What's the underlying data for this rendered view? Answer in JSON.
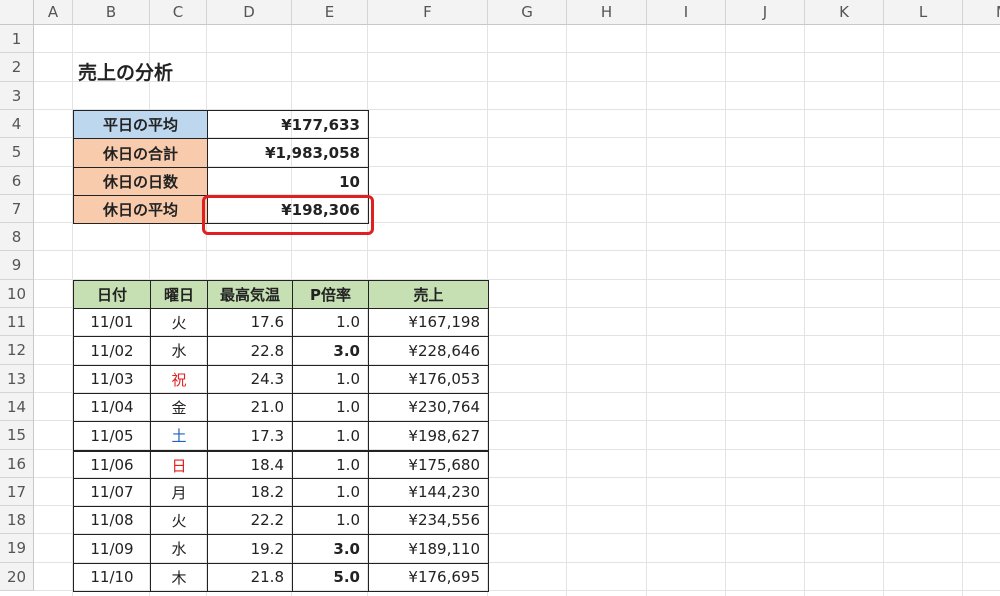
{
  "columns": [
    "A",
    "B",
    "C",
    "D",
    "E",
    "F",
    "G",
    "H",
    "I",
    "J",
    "K",
    "L",
    "M"
  ],
  "rows": [
    "1",
    "2",
    "3",
    "4",
    "5",
    "6",
    "7",
    "8",
    "9",
    "10",
    "11",
    "12",
    "13",
    "14",
    "15",
    "16",
    "17",
    "18",
    "19",
    "20"
  ],
  "title": "売上の分析",
  "summary": [
    {
      "label": "平日の平均",
      "value": "¥177,633"
    },
    {
      "label": "休日の合計",
      "value": "¥1,983,058"
    },
    {
      "label": "休日の日数",
      "value": "10"
    },
    {
      "label": "休日の平均",
      "value": "¥198,306"
    }
  ],
  "table": {
    "headers": [
      "日付",
      "曜日",
      "最高気温",
      "P倍率",
      "売上"
    ],
    "rows": [
      {
        "date": "11/01",
        "day": "火",
        "temp": "17.6",
        "rate": "1.0",
        "sales": "¥167,198"
      },
      {
        "date": "11/02",
        "day": "水",
        "temp": "22.8",
        "rate": "3.0",
        "sales": "¥228,646"
      },
      {
        "date": "11/03",
        "day": "祝",
        "temp": "24.3",
        "rate": "1.0",
        "sales": "¥176,053"
      },
      {
        "date": "11/04",
        "day": "金",
        "temp": "21.0",
        "rate": "1.0",
        "sales": "¥230,764"
      },
      {
        "date": "11/05",
        "day": "土",
        "temp": "17.3",
        "rate": "1.0",
        "sales": "¥198,627"
      },
      {
        "date": "11/06",
        "day": "日",
        "temp": "18.4",
        "rate": "1.0",
        "sales": "¥175,680"
      },
      {
        "date": "11/07",
        "day": "月",
        "temp": "18.2",
        "rate": "1.0",
        "sales": "¥144,230"
      },
      {
        "date": "11/08",
        "day": "火",
        "temp": "22.2",
        "rate": "1.0",
        "sales": "¥234,556"
      },
      {
        "date": "11/09",
        "day": "水",
        "temp": "19.2",
        "rate": "3.0",
        "sales": "¥189,110"
      },
      {
        "date": "11/10",
        "day": "木",
        "temp": "21.8",
        "rate": "5.0",
        "sales": "¥176,695"
      }
    ]
  },
  "colors": {
    "weekday_label_bg": "#bdd7ee",
    "holiday_label_bg": "#f8cbad",
    "table_header_bg": "#c6e0b4",
    "holiday_text": "#e02020",
    "saturday_text": "#2060c0",
    "selection_outline": "#e02020"
  }
}
